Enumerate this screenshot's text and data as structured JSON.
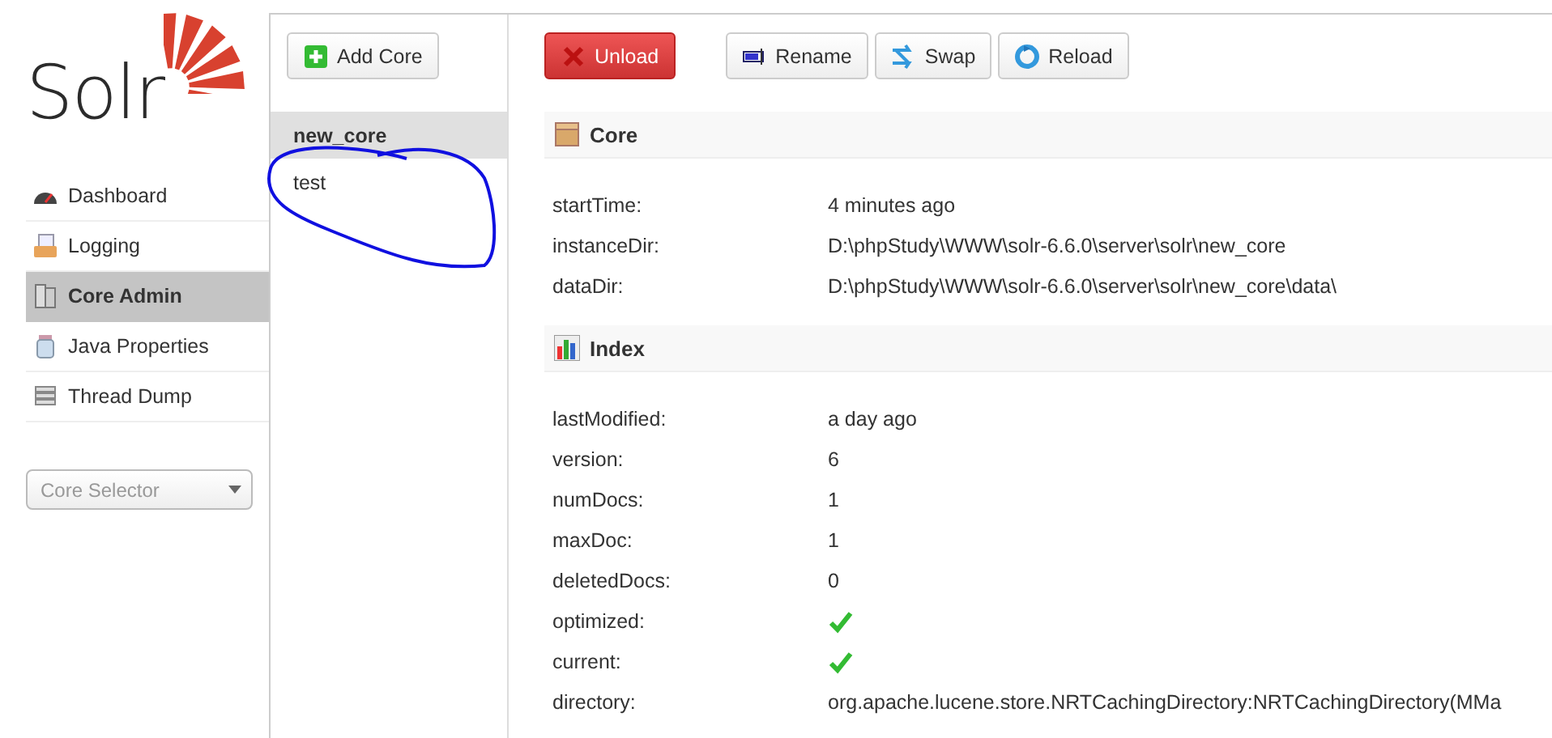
{
  "logo": {
    "text": "Solr"
  },
  "nav": [
    {
      "label": "Dashboard",
      "selected": false
    },
    {
      "label": "Logging",
      "selected": false
    },
    {
      "label": "Core Admin",
      "selected": true
    },
    {
      "label": "Java Properties",
      "selected": false
    },
    {
      "label": "Thread Dump",
      "selected": false
    }
  ],
  "core_selector": {
    "placeholder": "Core Selector"
  },
  "add_core_button": "Add Core",
  "cores": [
    {
      "name": "new_core",
      "selected": true
    },
    {
      "name": "test",
      "selected": false
    }
  ],
  "actions": [
    {
      "label": "Unload",
      "kind": "danger"
    },
    {
      "label": "Rename",
      "kind": "plain"
    },
    {
      "label": "Swap",
      "kind": "plain"
    },
    {
      "label": "Reload",
      "kind": "plain"
    }
  ],
  "sections": [
    {
      "title": "Core",
      "rows": [
        {
          "label": "startTime:",
          "kind": "text",
          "value": "4 minutes ago"
        },
        {
          "label": "instanceDir:",
          "kind": "text",
          "value": "D:\\phpStudy\\WWW\\solr-6.6.0\\server\\solr\\new_core"
        },
        {
          "label": "dataDir:",
          "kind": "text",
          "value": "D:\\phpStudy\\WWW\\solr-6.6.0\\server\\solr\\new_core\\data\\"
        }
      ]
    },
    {
      "title": "Index",
      "rows": [
        {
          "label": "lastModified:",
          "kind": "text",
          "value": "a day ago"
        },
        {
          "label": "version:",
          "kind": "text",
          "value": "6"
        },
        {
          "label": "numDocs:",
          "kind": "text",
          "value": "1"
        },
        {
          "label": "maxDoc:",
          "kind": "text",
          "value": "1"
        },
        {
          "label": "deletedDocs:",
          "kind": "text",
          "value": "0"
        },
        {
          "label": "optimized:",
          "kind": "flag",
          "checked": true
        },
        {
          "label": "current:",
          "kind": "flag",
          "checked": true
        },
        {
          "label": "directory:",
          "kind": "text",
          "value": "org.apache.lucene.store.NRTCachingDirectory:NRTCachingDirectory(MMa"
        }
      ]
    }
  ]
}
